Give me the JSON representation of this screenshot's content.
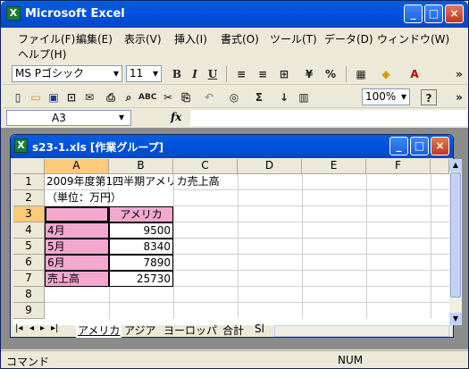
{
  "app": {
    "title": "Microsoft Excel",
    "icon_letter": "X"
  },
  "menu": {
    "items": [
      "ファイル(F)",
      "編集(E)",
      "表示(V)",
      "挿入(I)",
      "書式(O)",
      "ツール(T)",
      "データ(D)",
      "ウィンドウ(W)",
      "ヘルプ(H)"
    ]
  },
  "format_toolbar": {
    "font_name": "MS Pゴシック",
    "font_size": "11",
    "bold": "B",
    "italic": "I",
    "underline": "U",
    "percent": "%"
  },
  "standard_toolbar": {
    "sigma": "Σ",
    "zoom": "100%",
    "help": "?"
  },
  "formula_bar": {
    "name_box": "A3",
    "fx": "fx",
    "content": ""
  },
  "workbook": {
    "title": "s23-1.xls [作業グループ]"
  },
  "columns": [
    "A",
    "B",
    "C",
    "D",
    "E",
    "F"
  ],
  "rows": [
    "1",
    "2",
    "3",
    "4",
    "5",
    "6",
    "7",
    "8",
    "9"
  ],
  "cells": {
    "A1": "2009年度第1四半期アメリカ売上高",
    "A2": "（単位：万円）",
    "B3": "アメリカ",
    "A4": "4月",
    "B4": "9500",
    "A5": "5月",
    "B5": "8340",
    "A6": "6月",
    "B6": "7890",
    "A7": "売上高",
    "B7": "25730"
  },
  "sheet_tabs": [
    "アメリカ",
    "アジア",
    "ヨーロッパ",
    "合計",
    "Sl"
  ],
  "status": {
    "left": "コマンド",
    "right": "NUM"
  },
  "colors": {
    "pink": "#f2a8cf",
    "titlebar": "#0053e0"
  }
}
